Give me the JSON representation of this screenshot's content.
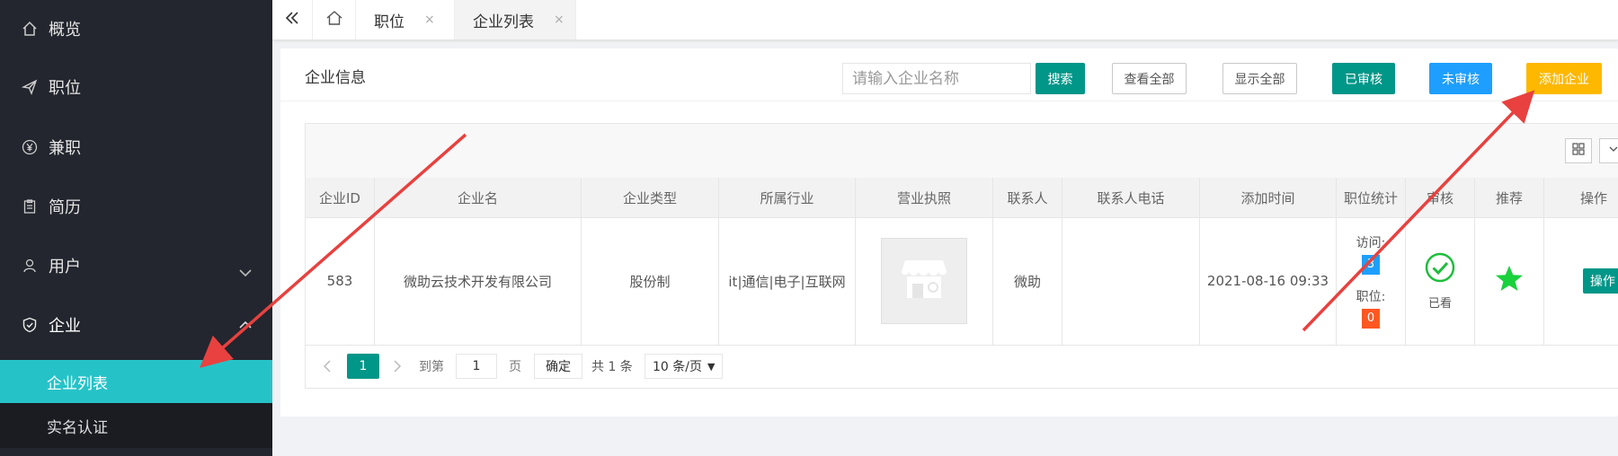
{
  "sidebar": {
    "items": [
      {
        "label": "概览",
        "icon": "home-icon"
      },
      {
        "label": "职位",
        "icon": "paper-plane-icon"
      },
      {
        "label": "兼职",
        "icon": "yen-icon"
      },
      {
        "label": "简历",
        "icon": "clipboard-icon"
      },
      {
        "label": "用户",
        "icon": "user-icon"
      },
      {
        "label": "企业",
        "icon": "shield-icon"
      }
    ],
    "sub_items": [
      {
        "label": "企业列表",
        "active": true
      },
      {
        "label": "实名认证",
        "active": false
      }
    ]
  },
  "tabs": {
    "collapse_icon": "double-chevron-left-icon",
    "home_icon": "home-icon",
    "items": [
      {
        "label": "职位",
        "close": "×"
      },
      {
        "label": "企业列表",
        "close": "×",
        "active": true
      }
    ]
  },
  "panel": {
    "title": "企业信息",
    "search_placeholder": "请输入企业名称",
    "buttons": {
      "search": "搜索",
      "view_all": "查看全部",
      "show_all": "显示全部",
      "approved": "已审核",
      "unapproved": "未审核",
      "add_company": "添加企业"
    }
  },
  "table": {
    "headers": [
      "企业ID",
      "企业名",
      "企业类型",
      "所属行业",
      "营业执照",
      "联系人",
      "联系人电话",
      "添加时间",
      "职位统计",
      "审核",
      "推荐",
      "操作"
    ],
    "rows": [
      {
        "id": "583",
        "name": "微助云技术开发有限公司",
        "type": "股份制",
        "industry": "it|通信|电子|互联网",
        "contact": "微助",
        "phone": "",
        "added": "2021-08-16 09:33",
        "visits_label": "访问:",
        "visits": "3",
        "jobs_label": "职位:",
        "jobs": "0",
        "review": "已看",
        "action": "操作"
      }
    ]
  },
  "pager": {
    "current": "1",
    "goto_label": "到第",
    "goto_value": "1",
    "page_label": "页",
    "confirm": "确定",
    "total": "共 1 条",
    "per_page": "10 条/页"
  },
  "colors": {
    "sidebar_bg": "#23262e",
    "active_teal": "#25c3c8",
    "primary_green": "#009688",
    "blue": "#1e9fff",
    "yellow": "#ffb800",
    "orange": "#ff5722",
    "arrow_red": "#e8413f"
  }
}
